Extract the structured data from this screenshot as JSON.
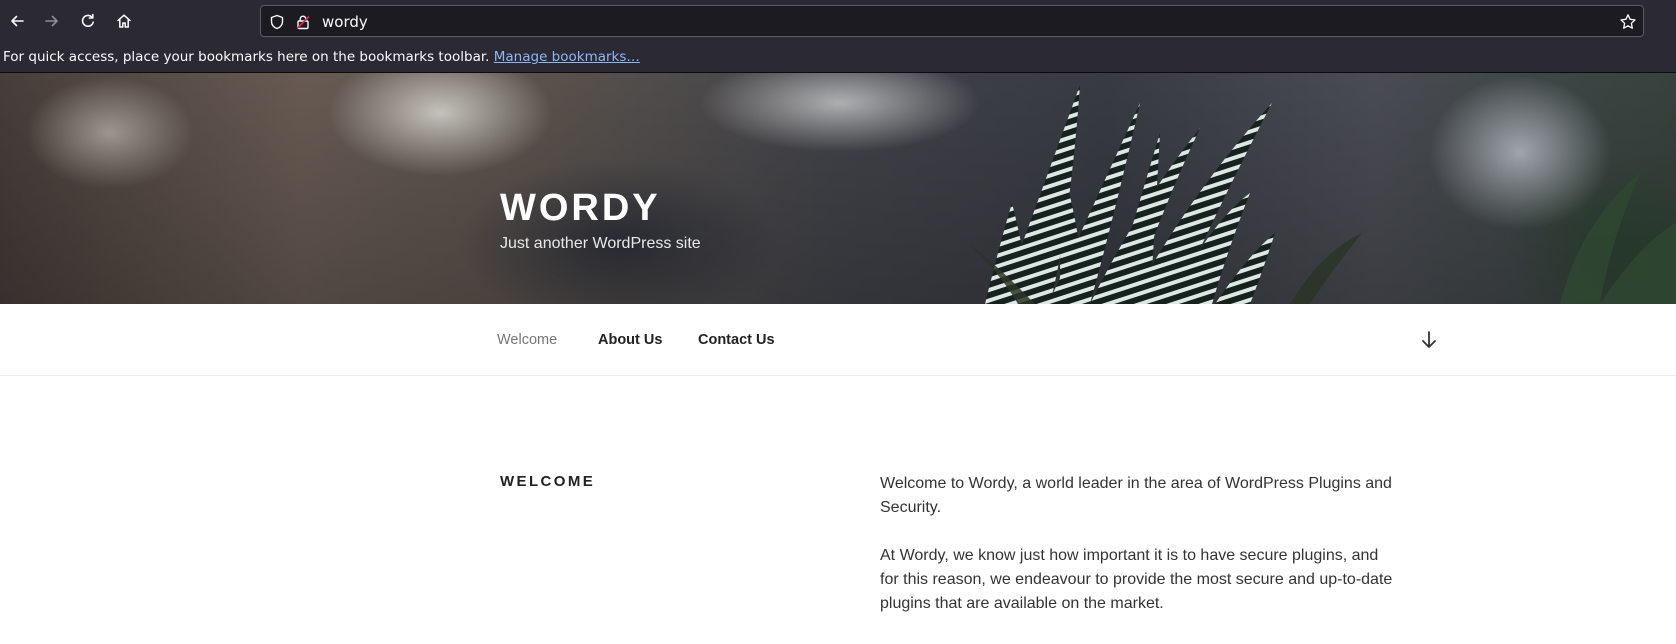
{
  "browser": {
    "url": "wordy",
    "icons": {
      "back": "arrow-left-icon",
      "forward": "arrow-right-icon",
      "reload": "reload-icon",
      "home": "home-icon",
      "shield": "shield-icon",
      "lock": "lock-icon",
      "bookmark": "star-icon"
    },
    "bookmarks_bar": {
      "text": "For quick access, place your bookmarks here on the bookmarks toolbar.",
      "link": "Manage bookmarks…"
    }
  },
  "site": {
    "title": "WORDY",
    "tagline": "Just another WordPress site"
  },
  "nav": {
    "items": [
      {
        "label": "Welcome",
        "current": true
      },
      {
        "label": "About Us",
        "current": false
      },
      {
        "label": "Contact Us",
        "current": false
      }
    ],
    "scroll_icon": "arrow-down-icon"
  },
  "content": {
    "heading": "WELCOME",
    "paragraphs": [
      "Welcome to Wordy, a world leader in the area of WordPress Plugins and Security.",
      "At Wordy, we know just how important it is to have secure plugins, and for this reason, we endeavour to provide the most secure and up-to-date plugins that are available on the market."
    ]
  },
  "colors": {
    "chrome_bg": "#2b2a33",
    "urlbar_bg": "#1c1b22",
    "link": "#8fb6f9",
    "text_dark": "#222222",
    "text_muted": "#767676"
  }
}
